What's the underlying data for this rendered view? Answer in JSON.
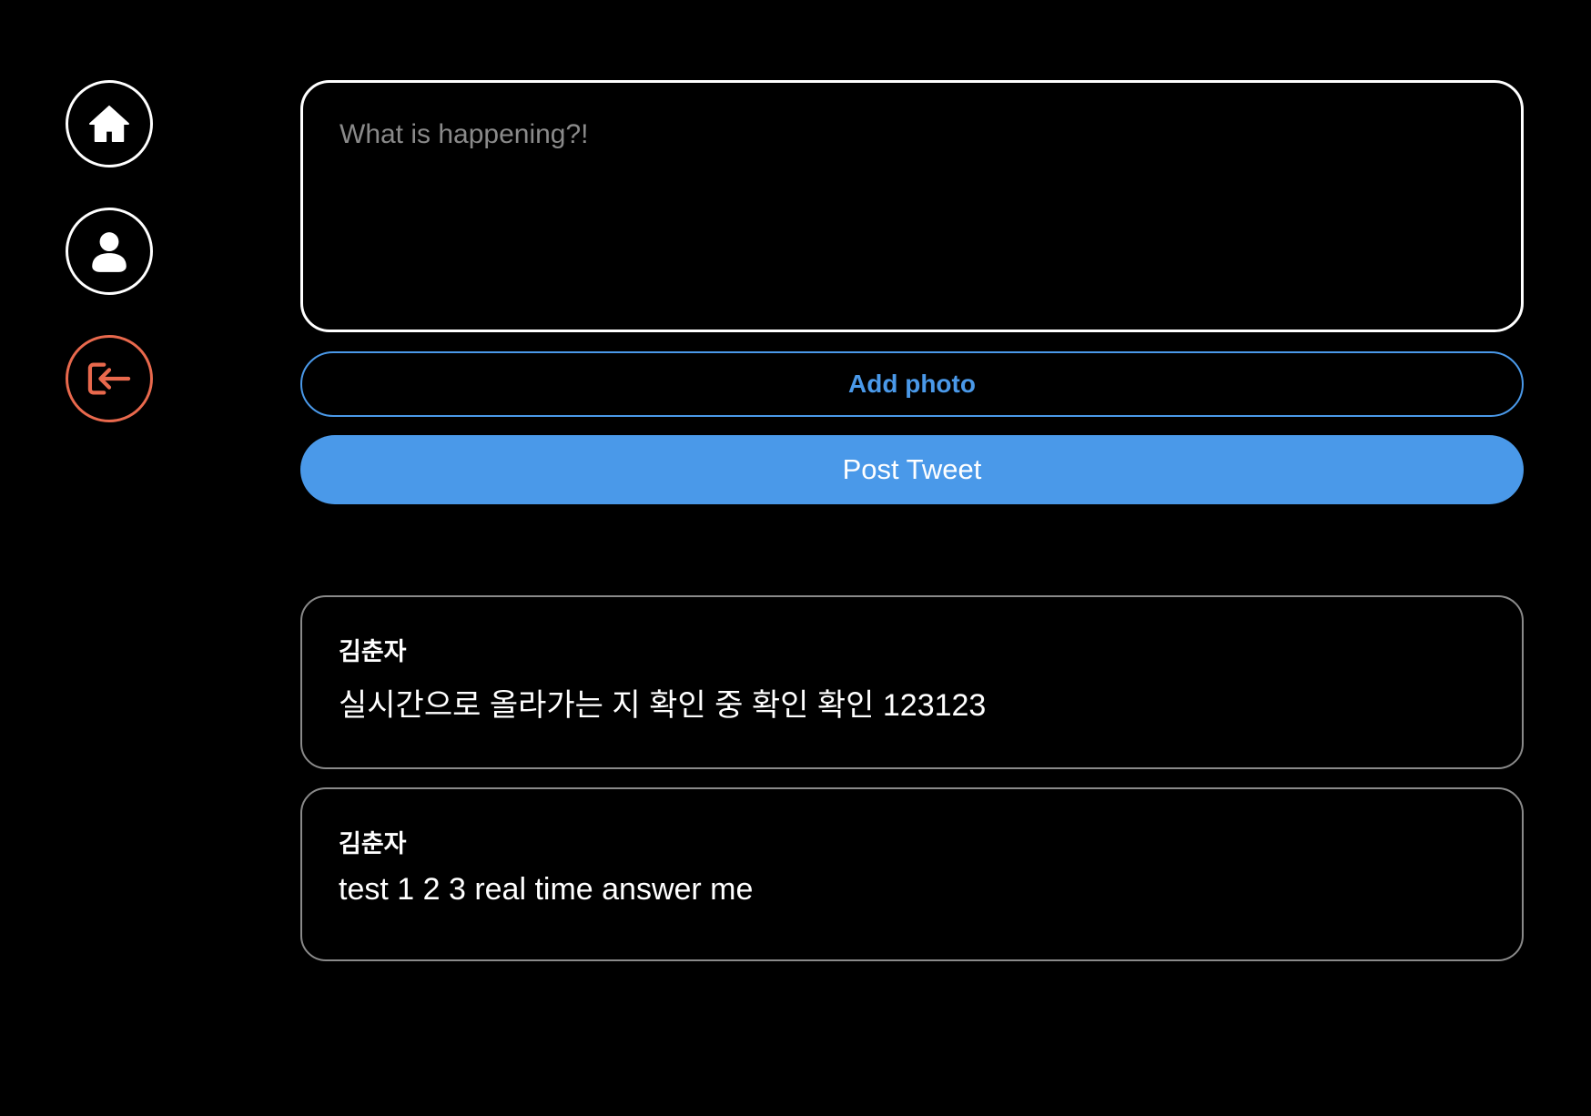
{
  "sidebar": {
    "items": [
      {
        "name": "home",
        "icon": "home-icon"
      },
      {
        "name": "profile",
        "icon": "user-icon"
      },
      {
        "name": "logout",
        "icon": "logout-icon",
        "color": "#e9694d"
      }
    ]
  },
  "compose": {
    "placeholder": "What is happening?!",
    "value": "",
    "add_photo_label": "Add photo",
    "post_label": "Post Tweet"
  },
  "colors": {
    "background": "#000000",
    "accent": "#4a99e9",
    "danger": "#e9694d",
    "border": "#8a8a8a"
  },
  "timeline": {
    "tweets": [
      {
        "username": "김춘자",
        "text": "실시간으로 올라가는 지 확인 중 확인 확인 123123"
      },
      {
        "username": "김춘자",
        "text": "test 1 2 3 real time answer me"
      }
    ]
  }
}
